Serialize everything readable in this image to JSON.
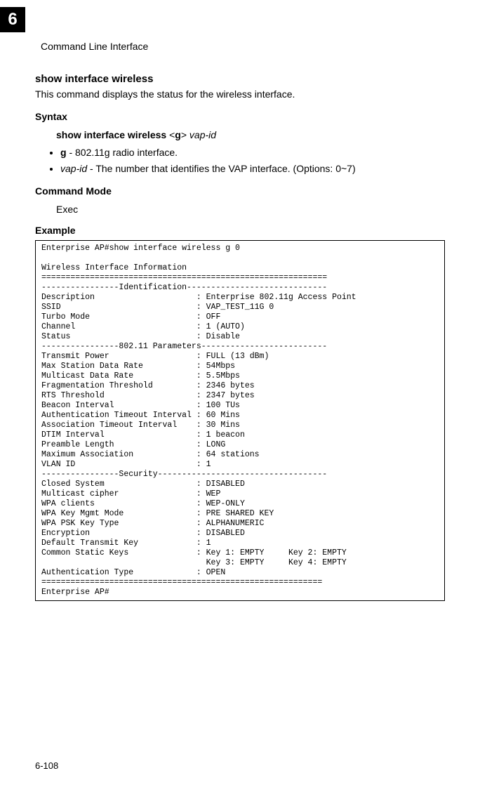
{
  "chapter_number": "6",
  "header_title": "Command Line Interface",
  "command_title": "show interface wireless",
  "command_desc": "This command displays the status for the wireless interface.",
  "syntax_label": "Syntax",
  "syntax_cmd_bold": "show interface wireless",
  "syntax_g_bold": "g",
  "syntax_vapid_italic": "vap-id",
  "bullets": {
    "b1_bold": "g",
    "b1_rest": " - 802.11g radio interface.",
    "b2_italic": "vap-id",
    "b2_rest": " - The number that identifies the VAP interface. (Options: 0~7)"
  },
  "mode_label": "Command Mode",
  "mode_value": "Exec",
  "example_label": "Example",
  "code": "Enterprise AP#show interface wireless g 0\n\nWireless Interface Information\n===========================================================\n----------------Identification-----------------------------\nDescription                     : Enterprise 802.11g Access Point\nSSID                            : VAP_TEST_11G 0\nTurbo Mode                      : OFF\nChannel                         : 1 (AUTO)\nStatus                          : Disable\n----------------802.11 Parameters--------------------------\nTransmit Power                  : FULL (13 dBm)\nMax Station Data Rate           : 54Mbps\nMulticast Data Rate             : 5.5Mbps\nFragmentation Threshold         : 2346 bytes\nRTS Threshold                   : 2347 bytes\nBeacon Interval                 : 100 TUs\nAuthentication Timeout Interval : 60 Mins\nAssociation Timeout Interval    : 30 Mins\nDTIM Interval                   : 1 beacon\nPreamble Length                 : LONG\nMaximum Association             : 64 stations\nVLAN ID                         : 1\n----------------Security-----------------------------------\nClosed System                   : DISABLED\nMulticast cipher                : WEP\nWPA clients                     : WEP-ONLY\nWPA Key Mgmt Mode               : PRE SHARED KEY\nWPA PSK Key Type                : ALPHANUMERIC\nEncryption                      : DISABLED\nDefault Transmit Key            : 1\nCommon Static Keys              : Key 1: EMPTY     Key 2: EMPTY\n                                  Key 3: EMPTY     Key 4: EMPTY\nAuthentication Type             : OPEN\n==========================================================\nEnterprise AP#",
  "footer": "6-108"
}
